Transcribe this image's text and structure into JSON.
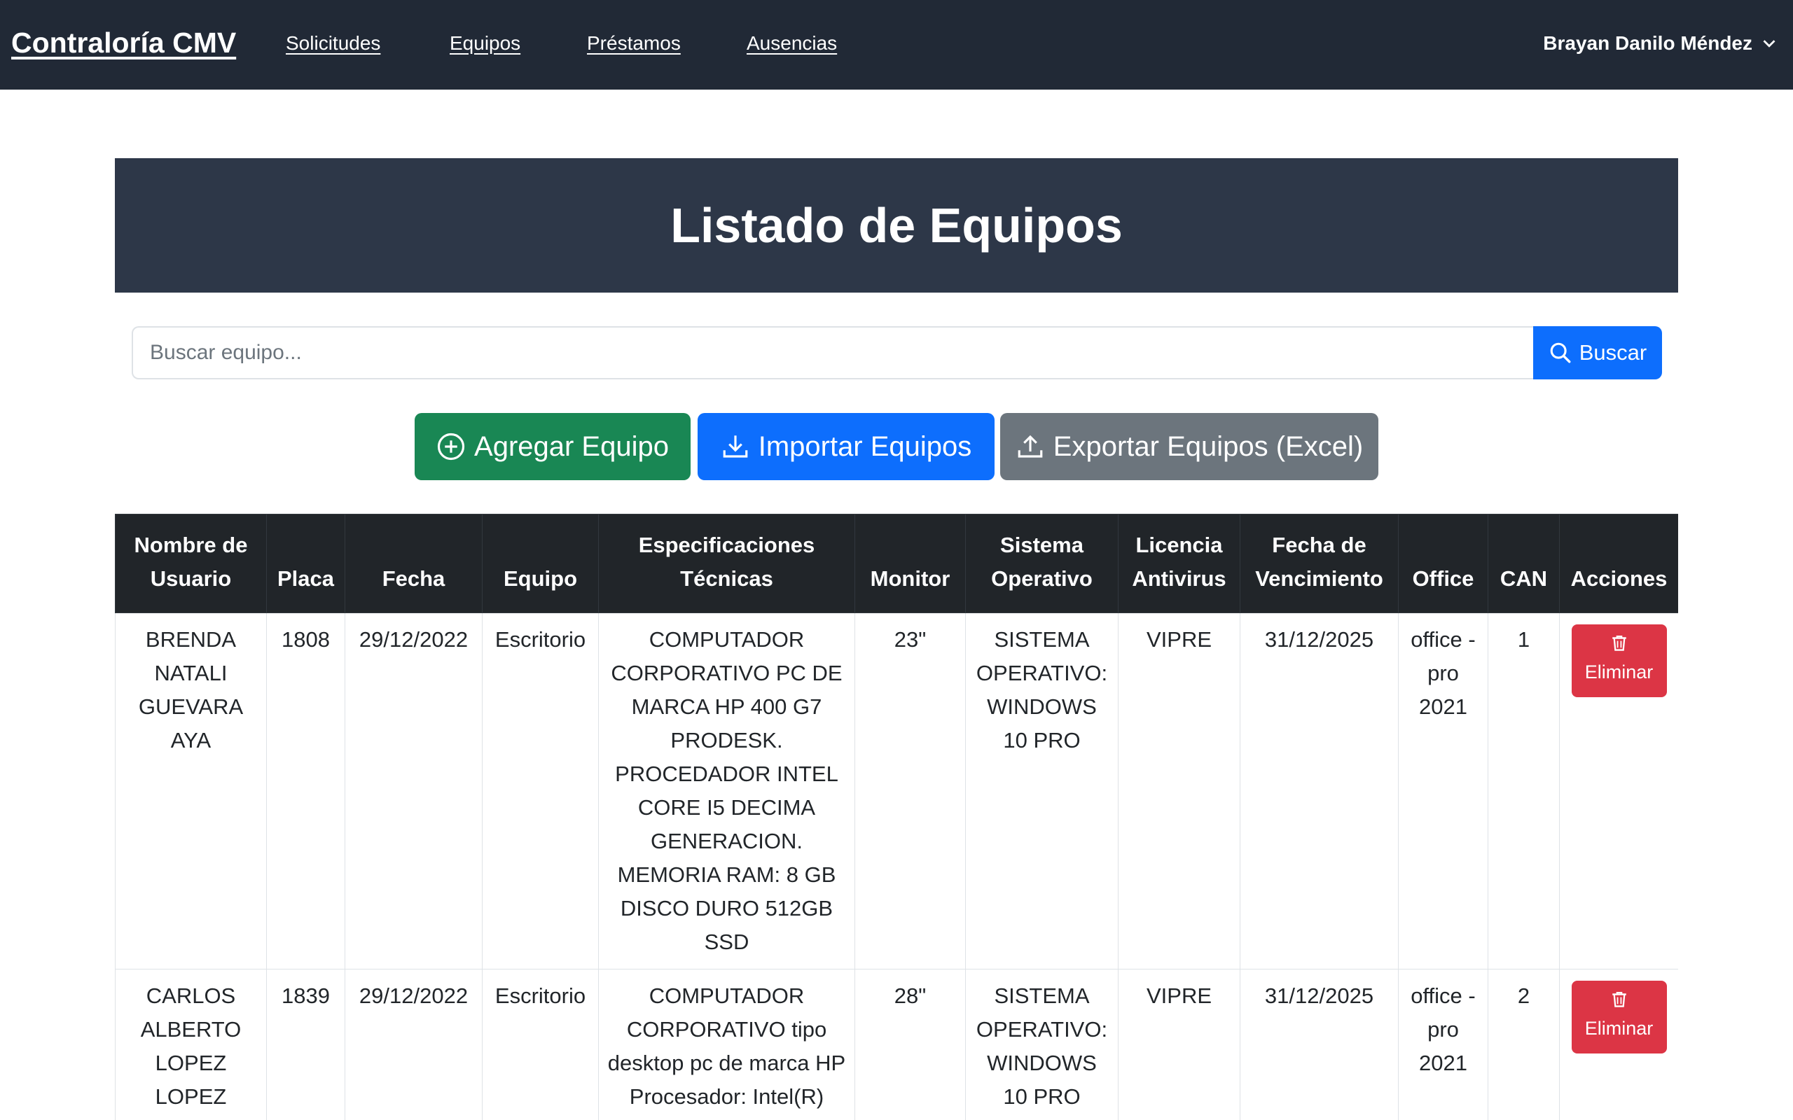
{
  "nav": {
    "brand": "Contraloría CMV",
    "links": [
      "Solicitudes",
      "Equipos",
      "Préstamos",
      "Ausencias"
    ],
    "user": "Brayan Danilo Méndez"
  },
  "page": {
    "title": "Listado de Equipos"
  },
  "search": {
    "placeholder": "Buscar equipo...",
    "button_label": "Buscar"
  },
  "actions": {
    "add_label": "Agregar Equipo",
    "import_label": "Importar Equipos",
    "export_label": "Exportar Equipos (Excel)"
  },
  "table": {
    "headers": [
      "Nombre de Usuario",
      "Placa",
      "Fecha",
      "Equipo",
      "Especificaciones Técnicas",
      "Monitor",
      "Sistema Operativo",
      "Licencia Antivirus",
      "Fecha de Vencimiento",
      "Office",
      "CAN",
      "Acciones"
    ],
    "delete_label": "Eliminar",
    "rows": [
      {
        "usuario": "BRENDA NATALI GUEVARA AYA",
        "placa": "1808",
        "fecha": "29/12/2022",
        "equipo": "Escritorio",
        "especificaciones": "COMPUTADOR CORPORATIVO PC DE MARCA HP 400 G7 PRODESK. PROCEDADOR INTEL CORE I5 DECIMA GENERACION. MEMORIA RAM: 8 GB DISCO DURO 512GB SSD",
        "monitor": "23\"",
        "sistema": "SISTEMA OPERATIVO: WINDOWS 10 PRO",
        "antivirus": "VIPRE",
        "vencimiento": "31/12/2025",
        "office": "office - pro 2021",
        "can": "1"
      },
      {
        "usuario": "CARLOS ALBERTO LOPEZ LOPEZ",
        "placa": "1839",
        "fecha": "29/12/2022",
        "equipo": "Escritorio",
        "especificaciones": "COMPUTADOR CORPORATIVO tipo desktop pc de marca HP Procesador: Intel(R)",
        "monitor": "28\"",
        "sistema": "SISTEMA OPERATIVO: WINDOWS 10 PRO",
        "antivirus": "VIPRE",
        "vencimiento": "31/12/2025",
        "office": "office - pro 2021",
        "can": "2"
      }
    ]
  },
  "colors": {
    "navbar": "#212936",
    "banner": "#2d3748",
    "primary": "#0d6efd",
    "success": "#198754",
    "secondary": "#6c757d",
    "danger": "#dc3545",
    "table_head": "#212529"
  },
  "icons": {
    "search": "search-icon",
    "add": "plus-circle-icon",
    "import": "download-icon",
    "export": "upload-icon",
    "delete": "trash-icon",
    "user_menu": "chevron-down-icon"
  }
}
